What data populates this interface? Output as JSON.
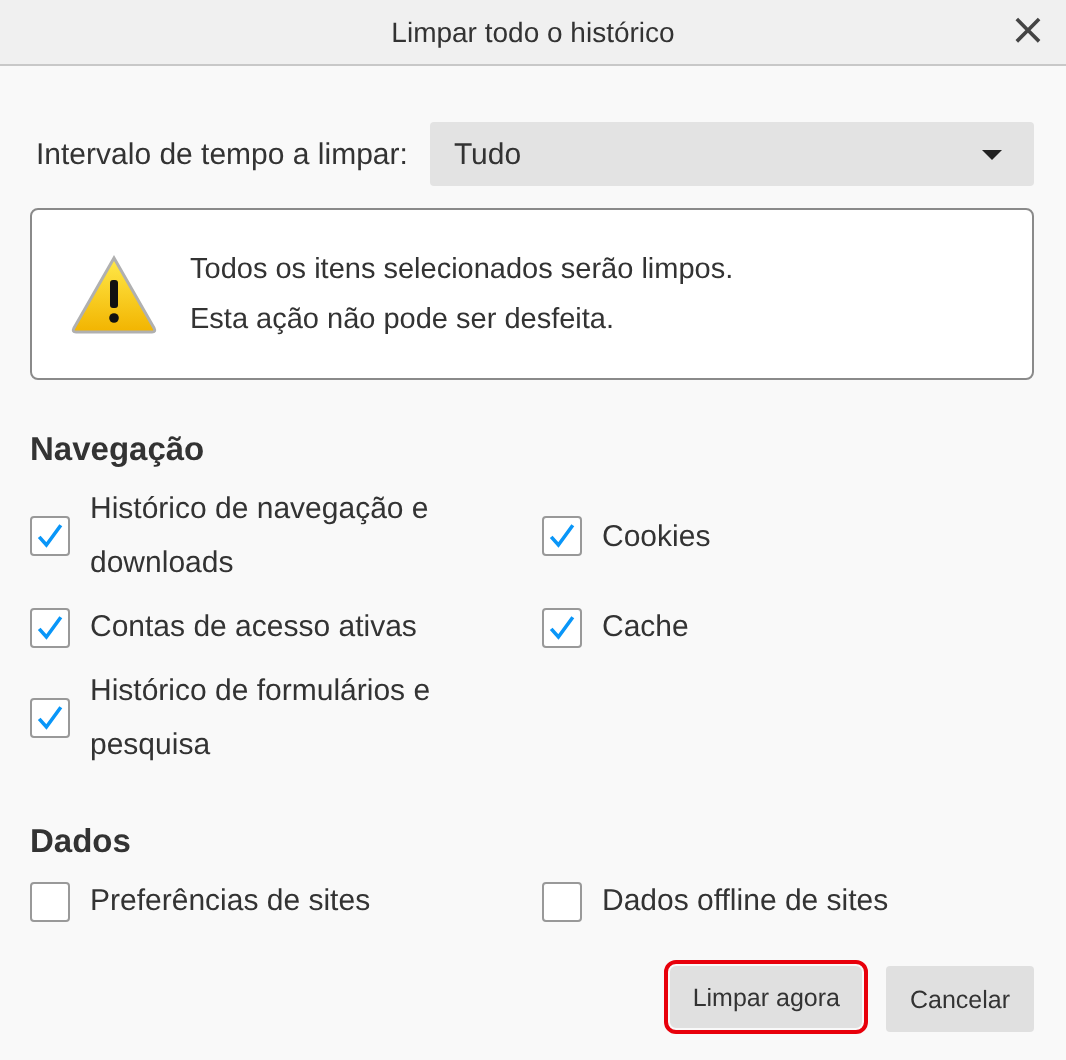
{
  "window": {
    "title": "Limpar todo o histórico",
    "close": "×"
  },
  "time_range": {
    "label": "Intervalo de tempo a limpar:",
    "value": "Tudo"
  },
  "warning": {
    "lines": [
      "Todos os itens selecionados serão limpos.",
      "Esta ação não pode ser desfeita."
    ]
  },
  "sections": [
    {
      "heading": "Navegação",
      "items": [
        {
          "label": "Histórico de navegação e downloads",
          "checked": true
        },
        {
          "label": "Cookies",
          "checked": true
        },
        {
          "label": "Contas de acesso ativas",
          "checked": true
        },
        {
          "label": "Cache",
          "checked": true
        },
        {
          "label": "Histórico de formulários e pesquisa",
          "checked": true
        }
      ]
    },
    {
      "heading": "Dados",
      "items": [
        {
          "label": "Preferências de sites",
          "checked": false
        },
        {
          "label": "Dados offline de sites",
          "checked": false
        }
      ]
    }
  ],
  "buttons": [
    {
      "label": "Limpar agora",
      "highlighted": true
    },
    {
      "label": "Cancelar",
      "highlighted": false
    }
  ]
}
